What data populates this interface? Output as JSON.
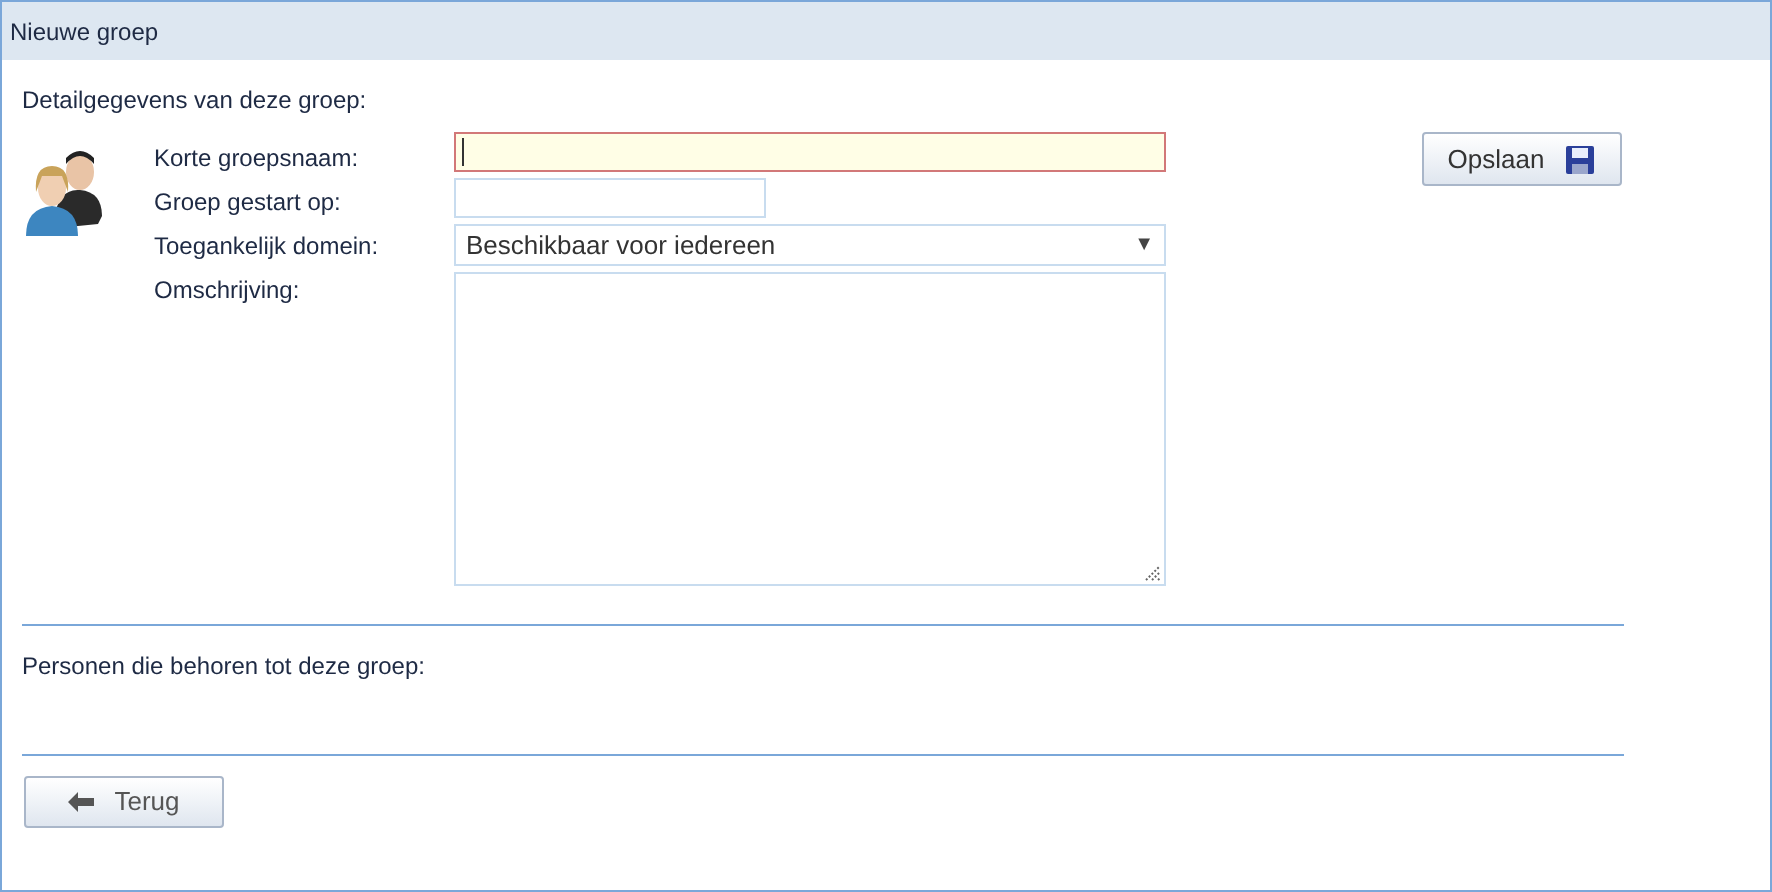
{
  "window": {
    "title": "Nieuwe groep"
  },
  "details": {
    "heading": "Detailgegevens van deze groep:",
    "fields": [
      {
        "kind": "text",
        "label": "Korte groepsnaam:",
        "focused": true
      },
      {
        "kind": "date",
        "label": "Groep gestart op:",
        "focused": false
      },
      {
        "kind": "select",
        "label": "Toegankelijk domein:",
        "value": "Beschikbaar voor iedereen",
        "arrow": "▼"
      },
      {
        "kind": "textarea",
        "label": "Omschrijving:"
      }
    ]
  },
  "save_button": {
    "label": "Opslaan"
  },
  "members": {
    "heading": "Personen die behoren tot deze groep:"
  },
  "back_button": {
    "label": "Terug"
  }
}
